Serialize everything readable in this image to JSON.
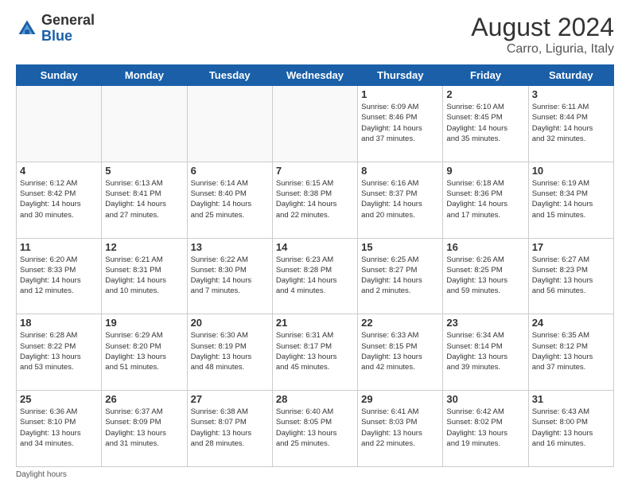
{
  "header": {
    "logo_general": "General",
    "logo_blue": "Blue",
    "month": "August 2024",
    "location": "Carro, Liguria, Italy"
  },
  "days_of_week": [
    "Sunday",
    "Monday",
    "Tuesday",
    "Wednesday",
    "Thursday",
    "Friday",
    "Saturday"
  ],
  "weeks": [
    [
      {
        "day": "",
        "info": ""
      },
      {
        "day": "",
        "info": ""
      },
      {
        "day": "",
        "info": ""
      },
      {
        "day": "",
        "info": ""
      },
      {
        "day": "1",
        "info": "Sunrise: 6:09 AM\nSunset: 8:46 PM\nDaylight: 14 hours\nand 37 minutes."
      },
      {
        "day": "2",
        "info": "Sunrise: 6:10 AM\nSunset: 8:45 PM\nDaylight: 14 hours\nand 35 minutes."
      },
      {
        "day": "3",
        "info": "Sunrise: 6:11 AM\nSunset: 8:44 PM\nDaylight: 14 hours\nand 32 minutes."
      }
    ],
    [
      {
        "day": "4",
        "info": "Sunrise: 6:12 AM\nSunset: 8:42 PM\nDaylight: 14 hours\nand 30 minutes."
      },
      {
        "day": "5",
        "info": "Sunrise: 6:13 AM\nSunset: 8:41 PM\nDaylight: 14 hours\nand 27 minutes."
      },
      {
        "day": "6",
        "info": "Sunrise: 6:14 AM\nSunset: 8:40 PM\nDaylight: 14 hours\nand 25 minutes."
      },
      {
        "day": "7",
        "info": "Sunrise: 6:15 AM\nSunset: 8:38 PM\nDaylight: 14 hours\nand 22 minutes."
      },
      {
        "day": "8",
        "info": "Sunrise: 6:16 AM\nSunset: 8:37 PM\nDaylight: 14 hours\nand 20 minutes."
      },
      {
        "day": "9",
        "info": "Sunrise: 6:18 AM\nSunset: 8:36 PM\nDaylight: 14 hours\nand 17 minutes."
      },
      {
        "day": "10",
        "info": "Sunrise: 6:19 AM\nSunset: 8:34 PM\nDaylight: 14 hours\nand 15 minutes."
      }
    ],
    [
      {
        "day": "11",
        "info": "Sunrise: 6:20 AM\nSunset: 8:33 PM\nDaylight: 14 hours\nand 12 minutes."
      },
      {
        "day": "12",
        "info": "Sunrise: 6:21 AM\nSunset: 8:31 PM\nDaylight: 14 hours\nand 10 minutes."
      },
      {
        "day": "13",
        "info": "Sunrise: 6:22 AM\nSunset: 8:30 PM\nDaylight: 14 hours\nand 7 minutes."
      },
      {
        "day": "14",
        "info": "Sunrise: 6:23 AM\nSunset: 8:28 PM\nDaylight: 14 hours\nand 4 minutes."
      },
      {
        "day": "15",
        "info": "Sunrise: 6:25 AM\nSunset: 8:27 PM\nDaylight: 14 hours\nand 2 minutes."
      },
      {
        "day": "16",
        "info": "Sunrise: 6:26 AM\nSunset: 8:25 PM\nDaylight: 13 hours\nand 59 minutes."
      },
      {
        "day": "17",
        "info": "Sunrise: 6:27 AM\nSunset: 8:23 PM\nDaylight: 13 hours\nand 56 minutes."
      }
    ],
    [
      {
        "day": "18",
        "info": "Sunrise: 6:28 AM\nSunset: 8:22 PM\nDaylight: 13 hours\nand 53 minutes."
      },
      {
        "day": "19",
        "info": "Sunrise: 6:29 AM\nSunset: 8:20 PM\nDaylight: 13 hours\nand 51 minutes."
      },
      {
        "day": "20",
        "info": "Sunrise: 6:30 AM\nSunset: 8:19 PM\nDaylight: 13 hours\nand 48 minutes."
      },
      {
        "day": "21",
        "info": "Sunrise: 6:31 AM\nSunset: 8:17 PM\nDaylight: 13 hours\nand 45 minutes."
      },
      {
        "day": "22",
        "info": "Sunrise: 6:33 AM\nSunset: 8:15 PM\nDaylight: 13 hours\nand 42 minutes."
      },
      {
        "day": "23",
        "info": "Sunrise: 6:34 AM\nSunset: 8:14 PM\nDaylight: 13 hours\nand 39 minutes."
      },
      {
        "day": "24",
        "info": "Sunrise: 6:35 AM\nSunset: 8:12 PM\nDaylight: 13 hours\nand 37 minutes."
      }
    ],
    [
      {
        "day": "25",
        "info": "Sunrise: 6:36 AM\nSunset: 8:10 PM\nDaylight: 13 hours\nand 34 minutes."
      },
      {
        "day": "26",
        "info": "Sunrise: 6:37 AM\nSunset: 8:09 PM\nDaylight: 13 hours\nand 31 minutes."
      },
      {
        "day": "27",
        "info": "Sunrise: 6:38 AM\nSunset: 8:07 PM\nDaylight: 13 hours\nand 28 minutes."
      },
      {
        "day": "28",
        "info": "Sunrise: 6:40 AM\nSunset: 8:05 PM\nDaylight: 13 hours\nand 25 minutes."
      },
      {
        "day": "29",
        "info": "Sunrise: 6:41 AM\nSunset: 8:03 PM\nDaylight: 13 hours\nand 22 minutes."
      },
      {
        "day": "30",
        "info": "Sunrise: 6:42 AM\nSunset: 8:02 PM\nDaylight: 13 hours\nand 19 minutes."
      },
      {
        "day": "31",
        "info": "Sunrise: 6:43 AM\nSunset: 8:00 PM\nDaylight: 13 hours\nand 16 minutes."
      }
    ]
  ],
  "footer": "Daylight hours"
}
